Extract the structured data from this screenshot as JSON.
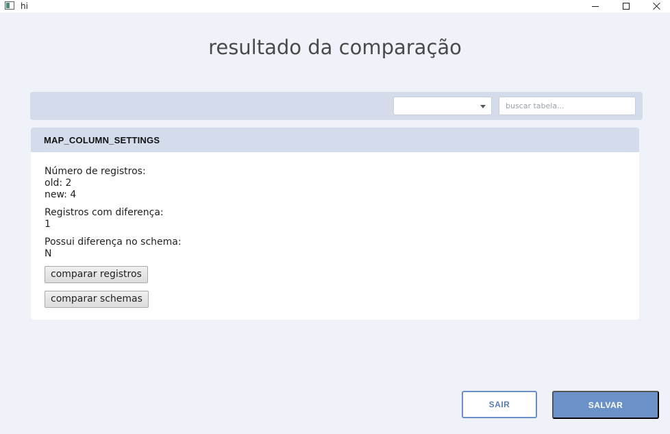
{
  "window": {
    "title": "hi",
    "icons": {
      "app": "app-icon",
      "minimize": "minimize-icon",
      "maximize": "maximize-icon",
      "close": "close-icon"
    }
  },
  "page": {
    "title": "resultado da comparação"
  },
  "filters": {
    "dropdown_value": "",
    "search_value": "",
    "search_placeholder": "buscar tabela...",
    "dropdown_icon": "chevron-down-icon"
  },
  "table_card": {
    "name": "MAP_COLUMN_SETTINGS",
    "records_label": "Número de registros:",
    "old_label": "old: 2",
    "new_label": "new: 4",
    "diff_label": "Registros com diferença:",
    "diff_value": "1",
    "schema_label": "Possui diferença no schema:",
    "schema_value": "N",
    "compare_records_button": "comparar registros",
    "compare_schemas_button": "comparar schemas"
  },
  "footer": {
    "exit_button": "SAIR",
    "save_button": "SALVAR"
  },
  "colors": {
    "background": "#eff2f9",
    "panel": "#d4dcec",
    "accent": "#6b91c9"
  }
}
